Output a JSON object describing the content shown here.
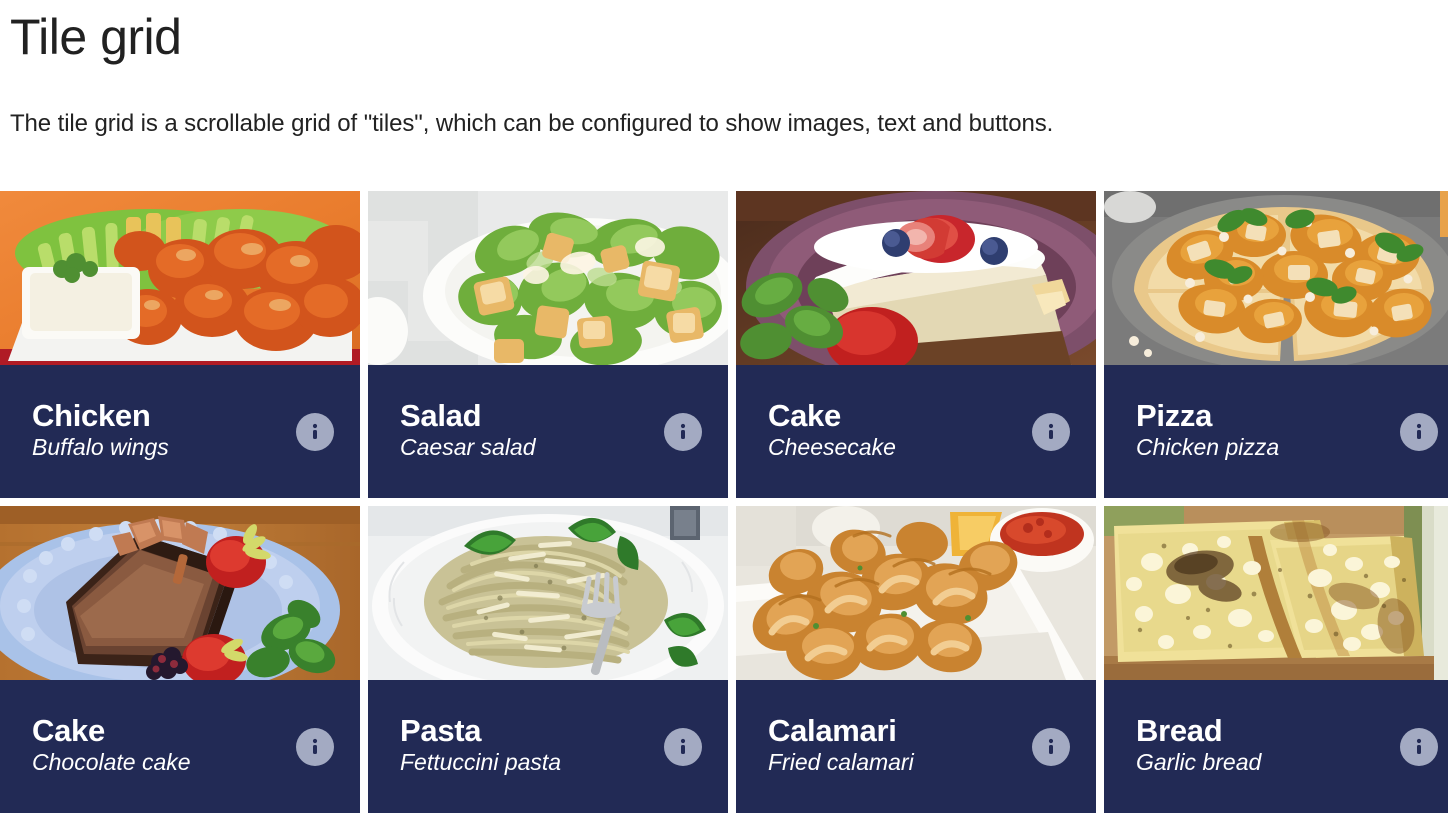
{
  "header": {
    "title": "Tile grid",
    "description": "The tile grid is a scrollable grid of \"tiles\", which can be configured to show images, text and buttons."
  },
  "colors": {
    "tile_background": "#222a55",
    "tile_text": "#ffffff",
    "info_button_background": "#a3aac2",
    "info_button_glyph": "#222a55",
    "page_background": "#ffffff",
    "title_text": "#212121"
  },
  "grid": {
    "columns": 4,
    "rows": 2,
    "tiles": [
      {
        "title": "Chicken",
        "subtitle": "Buffalo wings",
        "image_name": "buffalo-wings-photo",
        "button_icon": "info-icon"
      },
      {
        "title": "Salad",
        "subtitle": "Caesar salad",
        "image_name": "caesar-salad-photo",
        "button_icon": "info-icon"
      },
      {
        "title": "Cake",
        "subtitle": "Cheesecake",
        "image_name": "cheesecake-photo",
        "button_icon": "info-icon"
      },
      {
        "title": "Pizza",
        "subtitle": "Chicken pizza",
        "image_name": "chicken-pizza-photo",
        "button_icon": "info-icon"
      },
      {
        "title": "Cake",
        "subtitle": "Chocolate cake",
        "image_name": "chocolate-cake-photo",
        "button_icon": "info-icon"
      },
      {
        "title": "Pasta",
        "subtitle": "Fettuccini pasta",
        "image_name": "fettuccini-pasta-photo",
        "button_icon": "info-icon"
      },
      {
        "title": "Calamari",
        "subtitle": "Fried calamari",
        "image_name": "fried-calamari-photo",
        "button_icon": "info-icon"
      },
      {
        "title": "Bread",
        "subtitle": "Garlic bread",
        "image_name": "garlic-bread-photo",
        "button_icon": "info-icon"
      }
    ]
  }
}
